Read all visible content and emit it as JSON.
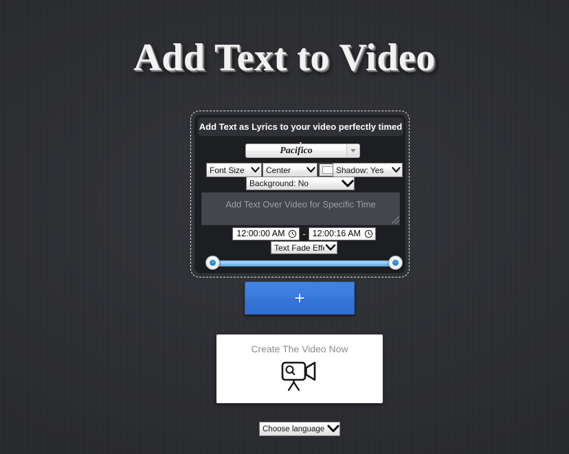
{
  "page": {
    "title": "Add Text to Video"
  },
  "text_block": {
    "heading": "Add Text as Lyrics to your video perfectly timed !",
    "font_select": {
      "value": "Pacifico",
      "arrow_icon": "triangle-down-icon"
    },
    "font_size": {
      "label": "Font Size",
      "chevron_icon": "chevron-down-icon"
    },
    "alignment": {
      "label": "Center",
      "chevron_icon": "chevron-down-icon"
    },
    "text_color": {
      "name": "text-color-picker",
      "value": "#ffffff"
    },
    "shadow": {
      "label": "Shadow: Yes",
      "chevron_icon": "chevron-down-icon"
    },
    "background": {
      "label": "Background: No",
      "chevron_icon": "chevron-down-icon"
    },
    "lyrics_textarea": {
      "placeholder": "Add Text Over Video for Specific Time",
      "value": "",
      "resize_grip_icon": "resize-grip-icon"
    },
    "time_range": {
      "start": "12:00:00 AM",
      "end": "12:00:16 AM",
      "separator": "-",
      "clock_icon": "clock-icon"
    },
    "effect": {
      "label": "Text Fade Effect",
      "chevron_icon": "chevron-down-icon"
    },
    "slider": {
      "name": "time-range-slider",
      "start_handle_percent": 0,
      "end_handle_percent": 100,
      "track_color": "#8fc6ef",
      "handle_dot_color": "#1f7fd0"
    }
  },
  "add_button": {
    "label": "+",
    "icon": "plus-icon",
    "color": "#3a7ade"
  },
  "create_card": {
    "label": "Create The Video Now",
    "icon": "video-camera-icon",
    "icon_letter": "Q"
  },
  "language_select": {
    "label": "Choose language",
    "chevron_icon": "chevron-down-icon"
  }
}
